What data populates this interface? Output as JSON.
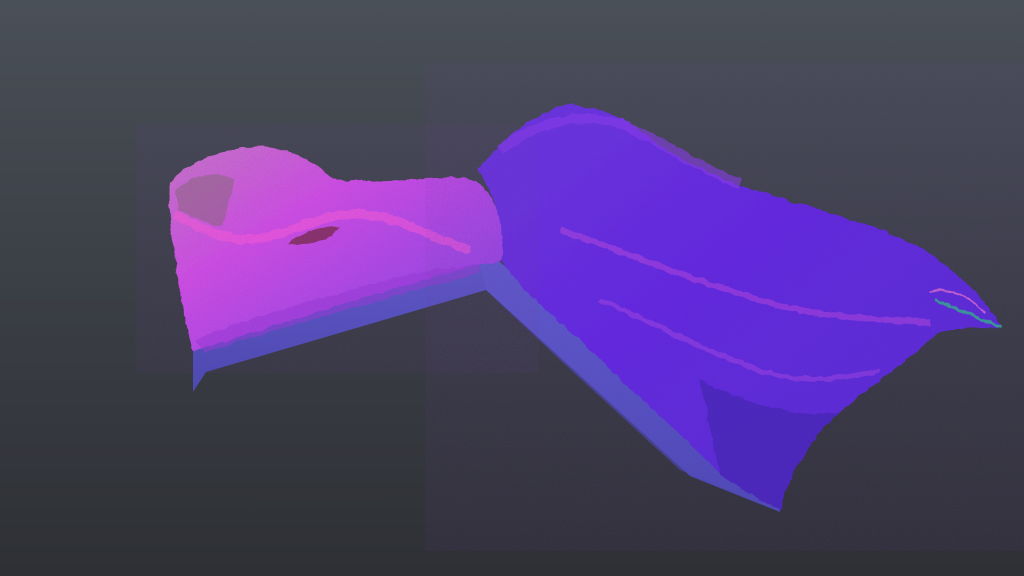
{
  "viewport": {
    "background_top": "#4a5058",
    "background_bottom": "#2e3035"
  },
  "mesh": {
    "shading": "normal-map",
    "palette": {
      "base_side": "#5a55c8",
      "slope_violet": "#6a2be0",
      "ridge_magenta": "#c84ee0",
      "highlight_pink": "#ff5bd8",
      "shadow_indigo": "#3a22a8",
      "edge_green": "#2fb78a"
    }
  }
}
